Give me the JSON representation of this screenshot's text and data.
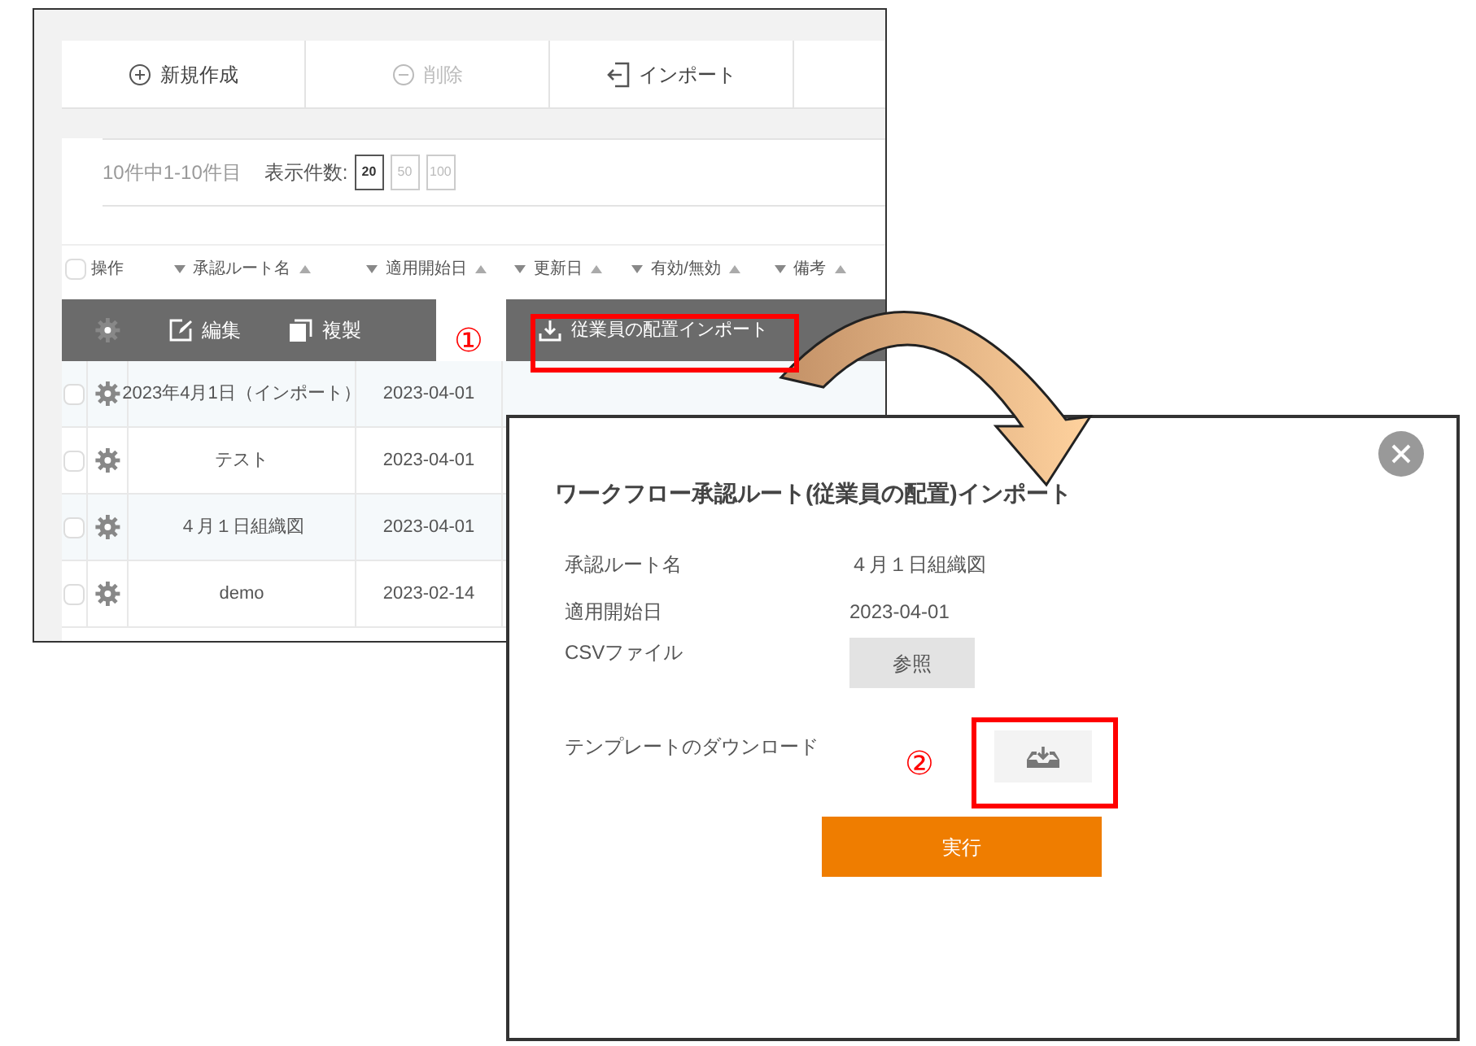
{
  "background_window": {
    "toolbar": [
      {
        "label": "新規作成",
        "kind": "add",
        "disabled": false
      },
      {
        "label": "削除",
        "kind": "remove",
        "disabled": true
      },
      {
        "label": "インポート",
        "kind": "import",
        "disabled": false
      }
    ],
    "record_count": "10件中1-10件目",
    "page_size_label": "表示件数:",
    "page_sizes": [
      {
        "label": "20",
        "selected": true
      },
      {
        "label": "50",
        "selected": false
      },
      {
        "label": "100",
        "selected": false
      }
    ],
    "header_checked": false,
    "columns": [
      "操作",
      "承認ルート名",
      "適用開始日",
      "更新日",
      "有効/無効",
      "備考"
    ],
    "action_bar": [
      {
        "label": "編集",
        "kind": "edit"
      },
      {
        "label": "複製",
        "kind": "copy"
      }
    ],
    "action_bar_right": {
      "label": "従業員の配置インポート",
      "kind": "download"
    },
    "rows": [
      {
        "name": "2023年4月1日（インポート）",
        "start_date": "2023-04-01",
        "checked": false
      },
      {
        "name": "テスト",
        "start_date": "2023-04-01",
        "checked": false
      },
      {
        "name": "４月１日組織図",
        "start_date": "2023-04-01",
        "checked": false
      },
      {
        "name": "demo",
        "start_date": "2023-02-14",
        "checked": false
      }
    ]
  },
  "callouts": [
    "①",
    "②"
  ],
  "dialog": {
    "title": "ワークフロー承認ルート(従業員の配置)インポート",
    "fields": [
      {
        "label": "承認ルート名",
        "kind": "text",
        "value": "４月１日組織図"
      },
      {
        "label": "適用開始日",
        "kind": "text",
        "value": "2023-04-01"
      },
      {
        "label": "CSVファイル",
        "kind": "file",
        "button": "参照"
      },
      {
        "label": "テンプレートのダウンロード",
        "kind": "download"
      }
    ],
    "submit": "実行"
  }
}
